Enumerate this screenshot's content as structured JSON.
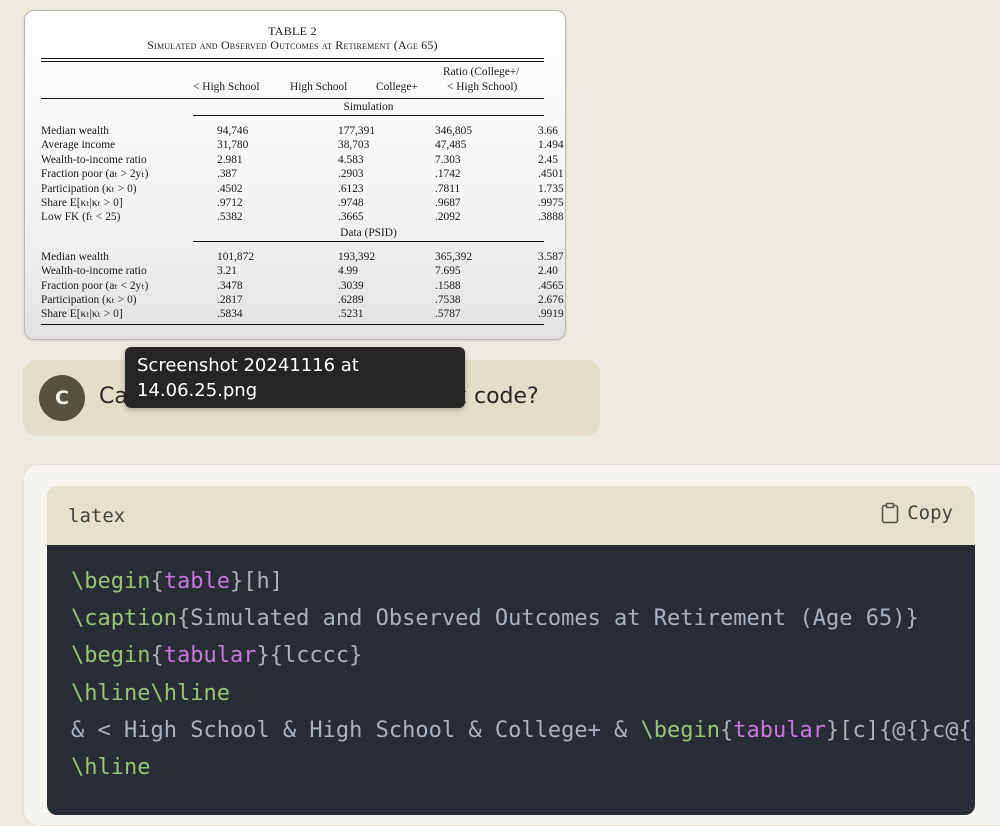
{
  "attachment": {
    "table_number": "TABLE 2",
    "table_caption": "Simulated and Observed Outcomes at Retirement (Age 65)",
    "columns": [
      "< High School",
      "High School",
      "College+",
      "Ratio (College+/",
      "< High School)"
    ],
    "sections": [
      {
        "label": "Simulation",
        "rows": [
          {
            "label": "Median wealth",
            "values": [
              "94,746",
              "177,391",
              "346,805",
              "3.66"
            ]
          },
          {
            "label": "Average income",
            "values": [
              "31,780",
              "38,703",
              "47,485",
              "1.494"
            ]
          },
          {
            "label": "Wealth-to-income ratio",
            "values": [
              "2.981",
              "4.583",
              "7.303",
              "2.45"
            ]
          },
          {
            "label": "Fraction poor (aₜ > 2yₜ)",
            "values": [
              ".387",
              ".2903",
              ".1742",
              ".4501"
            ]
          },
          {
            "label": "Participation (κₜ > 0)",
            "values": [
              ".4502",
              ".6123",
              ".7811",
              "1.735"
            ]
          },
          {
            "label": "Share E[κₜ|κₜ > 0]",
            "values": [
              ".9712",
              ".9748",
              ".9687",
              ".9975"
            ]
          },
          {
            "label": "Low FK (fₜ < 25)",
            "values": [
              ".5382",
              ".3665",
              ".2092",
              ".3888"
            ]
          }
        ]
      },
      {
        "label": "Data (PSID)",
        "rows": [
          {
            "label": "Median wealth",
            "values": [
              "101,872",
              "193,392",
              "365,392",
              "3.587"
            ]
          },
          {
            "label": "Wealth-to-income ratio",
            "values": [
              "3.21",
              "4.99",
              "7.695",
              "2.40"
            ]
          },
          {
            "label": "Fraction poor (aₜ < 2yₜ)",
            "values": [
              ".3478",
              ".3039",
              ".1588",
              ".4565"
            ]
          },
          {
            "label": "Participation (κₜ > 0)",
            "values": [
              ".2817",
              ".6289",
              ".7538",
              "2.676"
            ]
          },
          {
            "label": "Share E[κₜ|κₜ > 0]",
            "values": [
              ".5834",
              ".5231",
              ".5787",
              ".9919"
            ]
          }
        ]
      }
    ]
  },
  "tooltip": {
    "filename": "Screenshot 20241116 at 14.06.25.png"
  },
  "user_message": {
    "avatar_initial": "C",
    "text": "Ca",
    "text_tail": "ex code?"
  },
  "code_block": {
    "language": "latex",
    "copy_label": "Copy",
    "lines": [
      [
        {
          "t": "\\begin",
          "c": "kw"
        },
        {
          "t": "{",
          "c": "pl"
        },
        {
          "t": "table",
          "c": "arg"
        },
        {
          "t": "}[h]",
          "c": "pl"
        }
      ],
      [
        {
          "t": "\\caption",
          "c": "kw"
        },
        {
          "t": "{Simulated and Observed Outcomes at Retirement (Age 65)}",
          "c": "pl"
        }
      ],
      [
        {
          "t": "\\begin",
          "c": "kw"
        },
        {
          "t": "{",
          "c": "pl"
        },
        {
          "t": "tabular",
          "c": "arg"
        },
        {
          "t": "}{lcccc}",
          "c": "pl"
        }
      ],
      [
        {
          "t": "\\hline\\hline",
          "c": "kw"
        }
      ],
      [
        {
          "t": "& < High School & High School & College+ & ",
          "c": "pl"
        },
        {
          "t": "\\begin",
          "c": "kw"
        },
        {
          "t": "{",
          "c": "pl"
        },
        {
          "t": "tabular",
          "c": "arg"
        },
        {
          "t": "}[c]{@{}c@{",
          "c": "pl"
        }
      ],
      [
        {
          "t": "\\hline",
          "c": "kw"
        }
      ]
    ]
  },
  "colors": {
    "page_bg": "#ece9df",
    "bubble_bg": "#e3ddca",
    "code_bg": "#282c34",
    "keyword": "#98c379",
    "argument": "#c678dd"
  }
}
